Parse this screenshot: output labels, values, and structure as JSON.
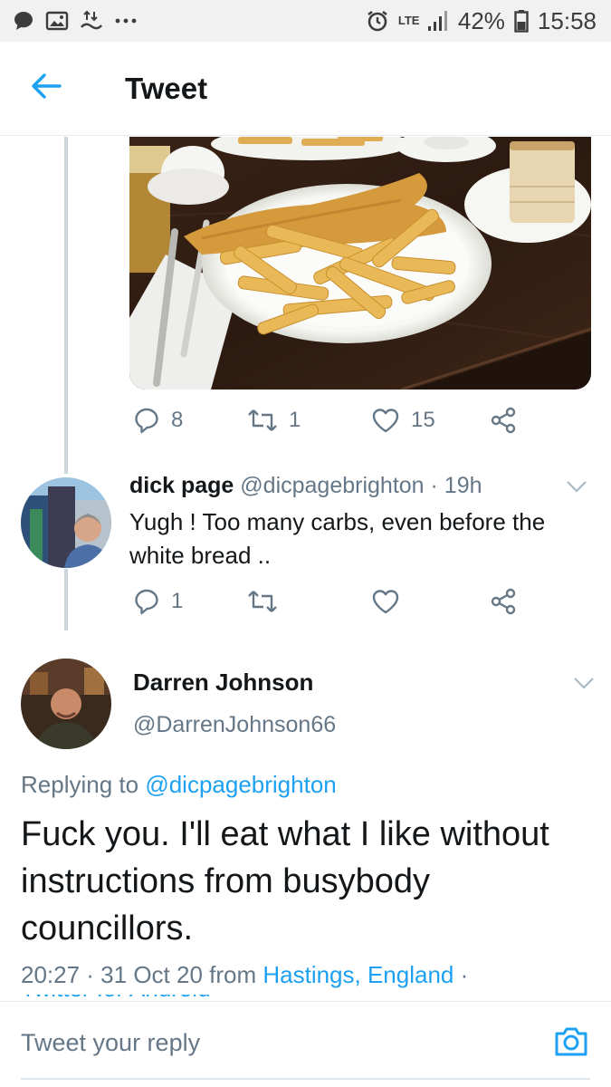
{
  "status_bar": {
    "network": "LTE",
    "battery": "42%",
    "time": "15:58",
    "icons": [
      "message-icon",
      "image-icon",
      "data-transfer-icon",
      "more-icon",
      "alarm-icon",
      "signal-icon",
      "battery-icon"
    ]
  },
  "header": {
    "title": "Tweet"
  },
  "image_tweet": {
    "stats": {
      "replies": "8",
      "retweets": "1",
      "likes": "15"
    },
    "photo_subject": "fish-and-chips-photo"
  },
  "reply": {
    "name": "dick page",
    "handle": "@dicpagebrighton",
    "separator": " · ",
    "age": "19h",
    "text": "Yugh ! Too many carbs, even before the white bread ..",
    "stats": {
      "replies": "1"
    }
  },
  "main_tweet": {
    "name": "Darren Johnson",
    "handle": "@DarrenJohnson66",
    "replying_prefix": "Replying to ",
    "replying_to": "@dicpagebrighton",
    "text": "Fuck you. I'll eat what I like without instructions from busybody councillors.",
    "time": "20:27 · 31 Oct 20 from ",
    "location": "Hastings, England",
    "trailing": " ·",
    "source_cut": "Twitter for Android"
  },
  "reply_bar": {
    "placeholder": "Tweet your reply"
  },
  "colors": {
    "accent": "#1da1f2",
    "secondary_text": "#657786",
    "thread_line": "#ccd6dd"
  }
}
